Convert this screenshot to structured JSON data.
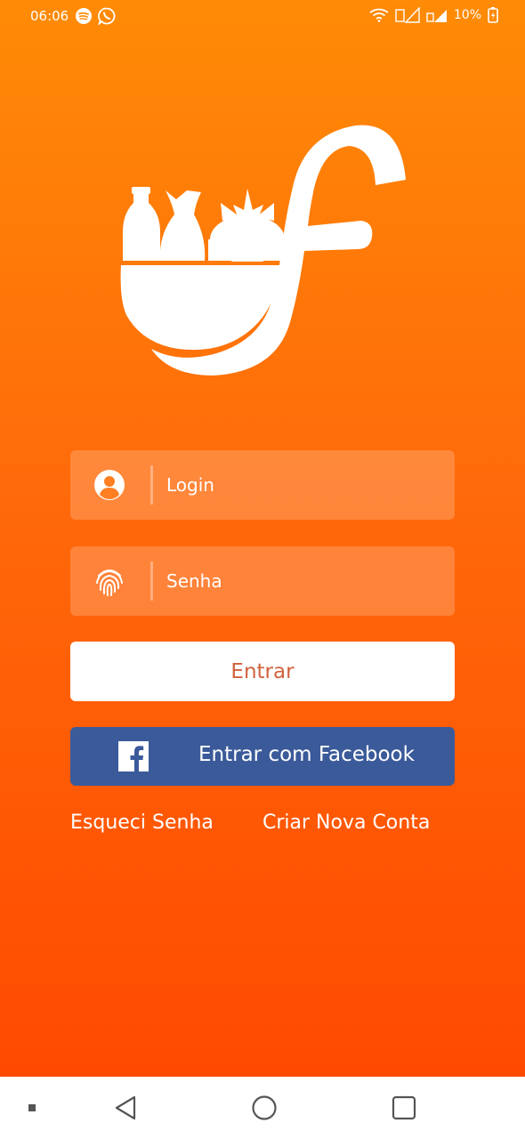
{
  "status_bar": {
    "time": "06:06",
    "battery_text": "10%",
    "left_icons": [
      "spotify-icon",
      "whatsapp-icon"
    ],
    "right_icons": [
      "wifi-icon",
      "signal-icon",
      "signal-icon",
      "battery-icon"
    ]
  },
  "logo": {
    "icon": "grocery-bag-logo-icon"
  },
  "login_field": {
    "placeholder": "Login",
    "value": "",
    "icon": "user-icon"
  },
  "password_field": {
    "placeholder": "Senha",
    "value": "",
    "icon": "fingerprint-icon"
  },
  "buttons": {
    "login_label": "Entrar",
    "facebook_label": "Entrar com Facebook",
    "facebook_icon": "facebook-icon"
  },
  "links": {
    "forgot_password": "Esqueci Senha",
    "create_account": "Criar Nova Conta"
  },
  "navigation": {
    "items": [
      "menu-dot-icon",
      "back-icon",
      "home-icon",
      "recents-icon"
    ]
  },
  "colors": {
    "gradient_top": "#ff8b06",
    "gradient_bottom": "#ff4a00",
    "login_button_text": "#d0623c",
    "facebook_blue": "#3b5a9a"
  }
}
